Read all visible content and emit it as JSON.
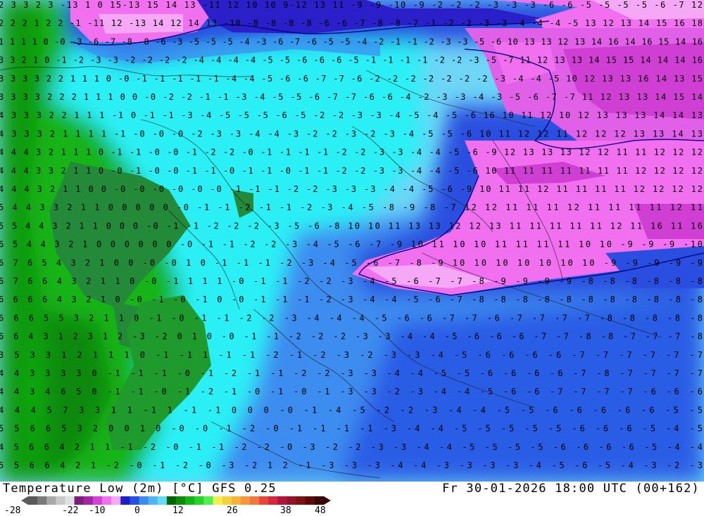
{
  "title": {
    "left": "Temperature Low (2m) [°C] GFS 0.25",
    "right": "Fr 30-01-2026 18:00 UTC (00+162)"
  },
  "colorbar": {
    "colors": [
      "#5a5a5a",
      "#7a7a7a",
      "#a8a8a8",
      "#c8c8c8",
      "#e0e0e0",
      "#7a1f7a",
      "#a426a4",
      "#d43fd4",
      "#f070f0",
      "#f5a8f5",
      "#1e1ec8",
      "#2850e6",
      "#3c8cf0",
      "#50b4f5",
      "#64dcfa",
      "#006400",
      "#0a8c0a",
      "#14b414",
      "#28d228",
      "#50f050",
      "#f0f050",
      "#f5d23c",
      "#f5b43c",
      "#f5963c",
      "#f0783c",
      "#e6463c",
      "#d2283c",
      "#b4143c",
      "#961428",
      "#781414",
      "#5a0a0a",
      "#3c0505"
    ],
    "tick_labels": [
      "-28",
      "-22",
      "-10",
      "0",
      "12",
      "26",
      "38",
      "48"
    ]
  },
  "map": {
    "contour_labels": [
      {
        "row": 0,
        "text": "2 3 3 2  3 -13 1 0 15-13 15 14 13 -11 12 10 10 9-12 13 11 -9 -9 -10 -9 -2 -2 -2 -3 -3 -3 -6 -6 -5 -5 -5 -5 -6 -7 12"
      },
      {
        "row": 1,
        "text": "2 2 2 1 2 2 -1 -11 12 -13 14 12 14 13 -10 -8 -8 -8 -8 -6 -6 -7 -8 -8 -7 -1 -2 -2 -3 -3 -4 -4 -4 -5 13 12 13 14 15 16 18"
      },
      {
        "row": 2,
        "text": "1 1 1 1 0 -0 -3 -6 -7 -8 -8 -6 -3 -5 -5 -5 -4 -3 -6 -7 -6 -5 -5 -4 -2 -1 -1 -2 -3 -3 -5 -6 10 13 13 12 13 14 16 14 16 15 14 16"
      },
      {
        "row": 3,
        "text": "3 3 2 1 0 -1 -2 -3 -3 -2 -2 -2 -2 -4 -4 -4 -4 -5 -5 -6 -6 -6 -5 -1 -1 -1 -1 -2 -2 -3 -5 -7 11 12 13 13 14 15 15 14 14 14 16"
      },
      {
        "row": 4,
        "text": "3 3 3 3 2 2 1 1 1 0 -0 -1 -1 -1 -1 -1 -4 -4 -5 -6 -6 -7 -7 -6 -2 -2 -2 -2 -2 -2 -2 -3 -4 -4 -5 10 12 13 13 16 14 13 15"
      },
      {
        "row": 5,
        "text": "3 3 3 3 2 2 2 1 1 1 0 0 -0 -2 -2 -1 -1 -3 -4 -5 -5 -6 -7 -7 -6 -6 -4 -2 -3 -3 -4 -3 -5 -6 -7 -7 11 12 13 13 14 15 14"
      },
      {
        "row": 6,
        "text": "4 3 3 3 2 2 1 1 1 -1 0 -1 -1 -3 -4 -5 -5 -5 -6 -5 -2 -2 -3 -3 -4 -5 -4 -5 -6 16 10 11 12 10 12 13 13 13 14 14 13"
      },
      {
        "row": 7,
        "text": "4 3 3 3 2 1 1 1 1 -1 -0 -0 -0 -2 -3 -3 -4 -4 -3 -2 -2 -3 -2 -3 -4 -5 -5 -6 10 11 12 12 11 12 12 12 13 13 14 13"
      },
      {
        "row": 8,
        "text": "4 4 4 3 2 1 1 1 0 -1 -1 -0 -0 -1 -2 -2 -0 -1 -1 -1 -1 -2 -2 -3 -3 -4 -4 -5 -6 -9 12 13 13 13 12 12 11 11 12 12 12"
      },
      {
        "row": 9,
        "text": "4 4 4 3 3 2 1 1 0 -0 -1 -0 -0 -1 -1 -0 -1 -1 -0 -1 -1 -2 -2 -3 -3 -4 -4 -5 -6 10 11 11 11 11 11 11 11 12 12 12 12"
      },
      {
        "row": 10,
        "text": "4 4 4 3 2 1 1 0 0 -0 -0 -0 -0 -0 -0 -1 -1 -1 -2 -2 -3 -3 -3 -4 -4 -5 -6 -9 10 11 11 12 11 11 11 11 12 12 12 12"
      },
      {
        "row": 11,
        "text": "5 4 4 3 3 2 1 1 0 0 0 0 0 -0 -1 -1 -2 -1 -1 -2 -3 -4 -5 -8 -9 -8 -7 12 12 11 11 11 12 11 11 11 11 12 11"
      },
      {
        "row": 12,
        "text": "5 5 4 4 3 2 1 1 0 0 0 -0 -1 -1 -2 -2 -2 -3 -5 -6 -8 10 10 11 13 13 12 12 13 11 11 11 11 11 12 11 16 11 16"
      },
      {
        "row": 13,
        "text": "6 5 4 4 3 2 1 0 0 0 0 0 0 -0 -1 -1 -2 -2 -3 -4 -5 -6 -7 -9 10 11 10 10 11 11 11 11 10 10 -9 -9 -9 -10"
      },
      {
        "row": 14,
        "text": "6 7 6 5 4 3 2 1 0 0 -0 -0 1 0 -1 -1 -1 -2 -3 -4 -5 -6 -7 -8 -9 10 10 10 10 10 10 10 -9 -9 -9 -9 -9"
      },
      {
        "row": 15,
        "text": "6 7 6 6 4 3 2 1 1 0 -0 -1 1 1 1 -0 -1 -1 -2 -2 -3 -4 -5 -6 -7 -7 -8 -9 -9 -9 -9 -8 -8 -8 -8 -8 -8"
      },
      {
        "row": 16,
        "text": "6 6 6 6 4 3 2 1 0 -0 -1 -0 -1 0 -0 -1 -1 -1 -2 -3 -4 -4 -5 -6 -7 -8 -8 -8 -8 -8 -8 -8 -8 -8 -8 -8"
      },
      {
        "row": 17,
        "text": "6 6 6 5 5 3 2 1 1 0 -1 -0 -1 -1 -2 -2 -3 -4 -4 -4 -5 -6 -6 -7 -7 -6 -7 -7 -7 -7 -8 -8 -8 -8 -8"
      },
      {
        "row": 18,
        "text": "6 6 4 3 1 2 3 1 2 -3 -2 0 1 0 -0 -1 -1 -2 -2 -2 -3 -3 -4 -4 -5 -6 -6 -6 -7 -7 -8 -8 -7 -7 -7 -8"
      },
      {
        "row": 19,
        "text": "3 5 3 3 1 2 1 1 1 0 -1 -1 1 -1 -1 -2 -1 -2 -3 -2 -3 -3 -4 -5 -6 -6 -6 -6 -7 -7 -7 -7 -7 -7"
      },
      {
        "row": 20,
        "text": "4 4 3 3 3 3 0 -1 -1 -1 -0 -1 -2 -1 -1 -2 -2 -3 -3 -4 -4 -5 -5 -6 -6 -6 -6 -7 -8 -7 -7 -7 -7"
      },
      {
        "row": 21,
        "text": "4 4 3 4 6 5 0 -1 -1 -0 -1 -2 -1 -0 -1 -0 -1 -3 -3 -2 -3 -4 -4 -5 -6 -6 -7 -7 -7 -7 -6 -6 -6"
      },
      {
        "row": 22,
        "text": "4 4 4 5 7 3 3 1 1 -1 1 -1 -1 0 0 0 -0 -1 -4 -5 -2 -2 -3 -4 -4 -5 -5 -6 -6 -6 -6 -6 -5 -5"
      },
      {
        "row": 23,
        "text": "5 5 6 6 5 3 2 0 0 1 0 -0 -0 -1 -2 -0 -1 -1 -1 -1 -3 -4 -4 -5 -5 -5 -5 -5 -6 -6 -6 -5 -4 -5"
      },
      {
        "row": 24,
        "text": "4 5 6 6 4 2 1 1 -1 -2 -0 -1 -1 -2 -2 -0 -3 -2 -2 -3 -3 -4 -4 -5 -5 -5 -5 -6 -6 -6 -6 -5 -4 -4"
      },
      {
        "row": 25,
        "text": "5 5 6 6 4 2 1 -2 -0 -1 -2 -0 -3 -2 1 2 -1 -3 -3 -3 -4 -4 -3 -3 -3 -3 -4 -5 -6 -5 -4 -3 -2 -3"
      }
    ]
  }
}
